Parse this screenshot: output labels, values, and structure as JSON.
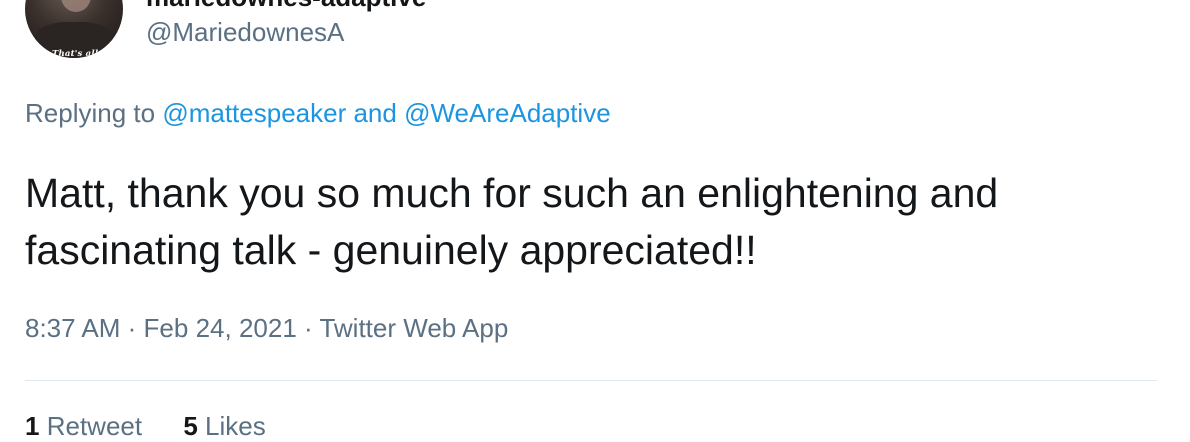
{
  "author": {
    "display_name": "mariedownes-adaptive",
    "handle": "@MariedownesA",
    "avatar_caption": "That's all"
  },
  "reply": {
    "prefix": "Replying to",
    "mention_1": "@mattespeaker",
    "joiner": "and",
    "mention_2": "@WeAreAdaptive"
  },
  "tweet": {
    "text": "Matt, thank you so much for such an enlightening and fascinating talk - genuinely appreciated!!"
  },
  "meta": {
    "time": "8:37 AM",
    "sep1": "·",
    "date": "Feb 24, 2021",
    "sep2": "·",
    "source": "Twitter Web App"
  },
  "stats": {
    "retweets_count": "1",
    "retweets_label": "Retweet",
    "likes_count": "5",
    "likes_label": "Likes"
  },
  "colors": {
    "link": "#1b95e0",
    "secondary_text": "#5b7083",
    "primary_text": "#14171a",
    "divider": "#e1e8ed"
  }
}
